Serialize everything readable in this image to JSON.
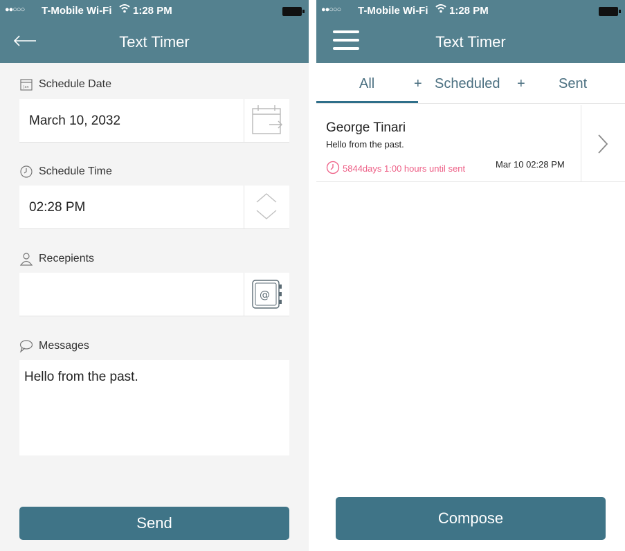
{
  "status_bar": {
    "signal": "●●○○○",
    "carrier": "T-Mobile Wi-Fi",
    "time": "1:28 PM"
  },
  "left_screen": {
    "title": "Text Timer",
    "schedule_date": {
      "label": "Schedule Date",
      "value": "March 10, 2032"
    },
    "schedule_time": {
      "label": "Schedule Time",
      "value": "02:28 PM"
    },
    "recipients": {
      "label": "Recepients",
      "value": ""
    },
    "messages": {
      "label": "Messages",
      "value": "Hello from the past."
    },
    "send_label": "Send",
    "calendar_icon_text": "Jan"
  },
  "right_screen": {
    "title": "Text Timer",
    "tabs": [
      {
        "label": "All",
        "active": true
      },
      {
        "label": "Scheduled"
      },
      {
        "label": "Sent"
      }
    ],
    "tab_separators": [
      "+",
      "+"
    ],
    "messages": [
      {
        "recipient": "George Tinari",
        "preview": "Hello from the past.",
        "countdown": "5844days 1:00 hours until sent",
        "date": "Mar 10 02:28 PM"
      }
    ],
    "compose_label": "Compose"
  },
  "colors": {
    "header": "#54818f",
    "button": "#3f7487",
    "tab_active": "#2f6f8a",
    "countdown": "#ee5f86"
  }
}
